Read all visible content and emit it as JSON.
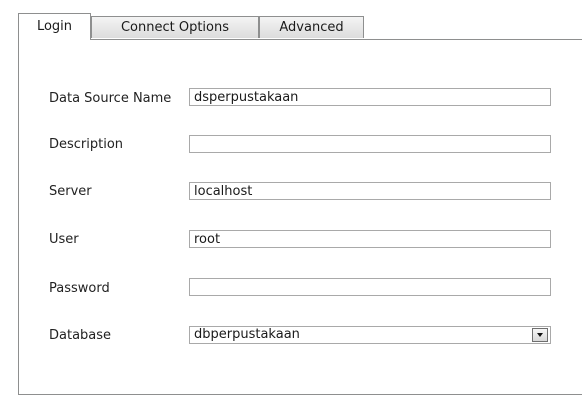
{
  "tabs": [
    {
      "label": "Login",
      "active": true
    },
    {
      "label": "Connect Options",
      "active": false
    },
    {
      "label": "Advanced",
      "active": false
    }
  ],
  "form": {
    "data_source_name": {
      "label": "Data Source Name",
      "value": "dsperpustakaan"
    },
    "description": {
      "label": "Description",
      "value": ""
    },
    "server": {
      "label": "Server",
      "value": "localhost"
    },
    "user": {
      "label": "User",
      "value": "root"
    },
    "password": {
      "label": "Password",
      "value": ""
    },
    "database": {
      "label": "Database",
      "value": "dbperpustakaan"
    }
  },
  "icons": {
    "dropdown": "chevron-down-icon"
  },
  "colors": {
    "border": "#8e8f8f",
    "input_border": "#a9a9a9",
    "background": "#ffffff"
  }
}
